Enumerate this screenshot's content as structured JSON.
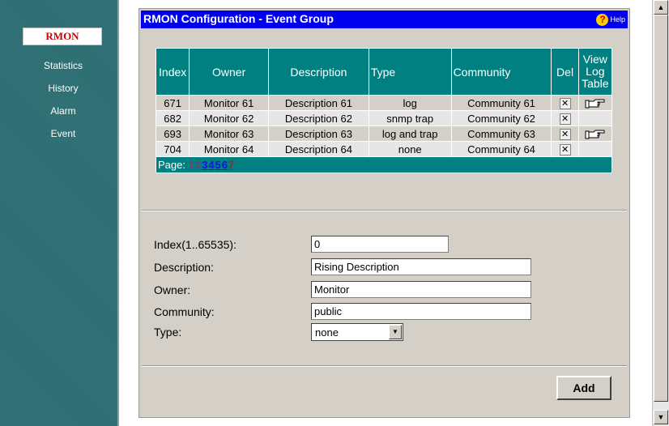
{
  "sidebar": {
    "active": "RMON",
    "items": [
      {
        "label": "Statistics"
      },
      {
        "label": "History"
      },
      {
        "label": "Alarm"
      },
      {
        "label": "Event"
      }
    ]
  },
  "title": "RMON Configuration - Event Group",
  "help_label": "Help",
  "table": {
    "headers": {
      "index": "Index",
      "owner": "Owner",
      "description": "Description",
      "type": "Type",
      "community": "Community",
      "del": "Del",
      "view_log": [
        "View",
        "Log",
        "Table"
      ]
    },
    "rows": [
      {
        "index": "671",
        "owner": "Monitor 61",
        "description": "Description 61",
        "type": "log",
        "community": "Community 61",
        "has_log": true
      },
      {
        "index": "682",
        "owner": "Monitor 62",
        "description": "Description 62",
        "type": "snmp trap",
        "community": "Community 62",
        "has_log": false
      },
      {
        "index": "693",
        "owner": "Monitor 63",
        "description": "Description 63",
        "type": "log and trap",
        "community": "Community 63",
        "has_log": true
      },
      {
        "index": "704",
        "owner": "Monitor 64",
        "description": "Description 64",
        "type": "none",
        "community": "Community 64",
        "has_log": false
      }
    ],
    "del_glyph": "✕",
    "log_icon": "pointing-hand-icon",
    "pager": {
      "label": "Page:",
      "pages": [
        "1",
        "2",
        "3",
        "4",
        "5",
        "6",
        "7"
      ]
    }
  },
  "form": {
    "index_label": "Index(1..65535):",
    "index_value": "0",
    "description_label": "Description:",
    "description_value": "Rising Description",
    "owner_label": "Owner:",
    "owner_value": "Monitor",
    "community_label": "Community:",
    "community_value": "public",
    "type_label": "Type:",
    "type_value": "none",
    "add_label": "Add"
  },
  "colors": {
    "sidebar": "#2d6e73",
    "title_bar": "#0000ee",
    "table_header": "#008080",
    "active_nav_text": "#cc0000"
  }
}
